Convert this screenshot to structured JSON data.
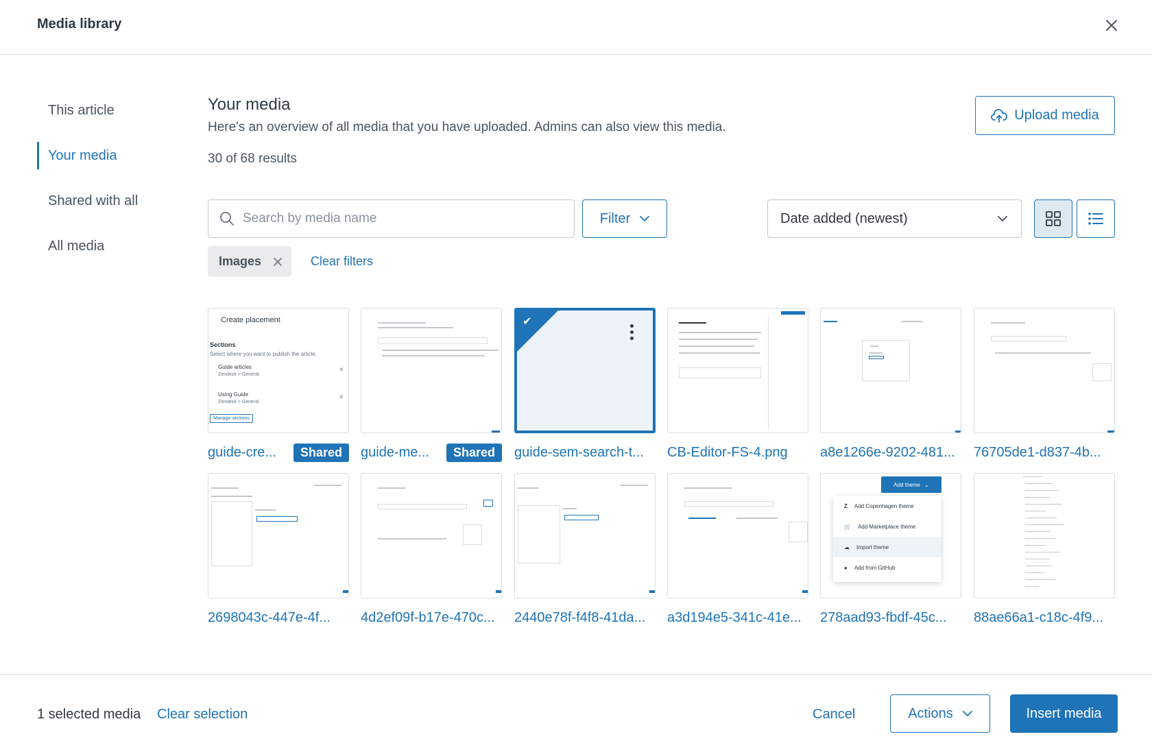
{
  "header": {
    "title": "Media library"
  },
  "sidebar": {
    "items": [
      {
        "label": "This article",
        "active": false
      },
      {
        "label": "Your media",
        "active": true
      },
      {
        "label": "Shared with all",
        "active": false
      },
      {
        "label": "All media",
        "active": false
      }
    ]
  },
  "main": {
    "title": "Your media",
    "subtitle": "Here's an overview of all media that you have uploaded. Admins can also view this media.",
    "results": "30 of 68 results",
    "upload_label": "Upload media",
    "search_placeholder": "Search by media name",
    "filter_label": "Filter",
    "sort_value": "Date added (newest)",
    "active_filter": "Images",
    "clear_filters": "Clear filters"
  },
  "media": [
    {
      "name": "guide-cre...",
      "badge": "Shared",
      "selected": false,
      "thumb_title": "Create placement",
      "thumb_sections": "Sections",
      "thumb_hint": "Select where you want to publish the article.",
      "thumb_item1": "Guide articles",
      "thumb_item2": "Using Guide",
      "thumb_crumb1": "Zendesk > General",
      "thumb_crumb2": "Zendesk > General",
      "thumb_btn": "Manage sections"
    },
    {
      "name": "guide-me...",
      "badge": "Shared",
      "selected": false
    },
    {
      "name": "guide-sem-search-t...",
      "badge": "",
      "selected": true
    },
    {
      "name": "CB-Editor-FS-4.png",
      "badge": "",
      "selected": false
    },
    {
      "name": "a8e1266e-9202-481...",
      "badge": "",
      "selected": false
    },
    {
      "name": "76705de1-d837-4b...",
      "badge": "",
      "selected": false
    },
    {
      "name": "2698043c-447e-4f...",
      "badge": "",
      "selected": false
    },
    {
      "name": "4d2ef09f-b17e-470c...",
      "badge": "",
      "selected": false
    },
    {
      "name": "2440e78f-f4f8-41da...",
      "badge": "",
      "selected": false
    },
    {
      "name": "a3d194e5-341c-41e...",
      "badge": "",
      "selected": false
    },
    {
      "name": "278aad93-fbdf-45c...",
      "badge": "",
      "selected": false,
      "thumb_button": "Add theme",
      "thumb_menu": [
        "Add Copenhagen theme",
        "Add Marketplace theme",
        "Import theme",
        "Add from GitHub"
      ]
    },
    {
      "name": "88ae66a1-c18c-4f9...",
      "badge": "",
      "selected": false
    }
  ],
  "footer": {
    "selected_count": "1 selected media",
    "clear_selection": "Clear selection",
    "cancel": "Cancel",
    "actions": "Actions",
    "insert": "Insert media"
  },
  "colors": {
    "accent": "#1f73b7",
    "text": "#2f3941",
    "border": "#d8dcde"
  },
  "icons": [
    "close-icon",
    "upload-cloud-icon",
    "search-icon",
    "chevron-down-icon",
    "grid-view-icon",
    "list-view-icon",
    "check-icon",
    "more-vertical-icon"
  ]
}
